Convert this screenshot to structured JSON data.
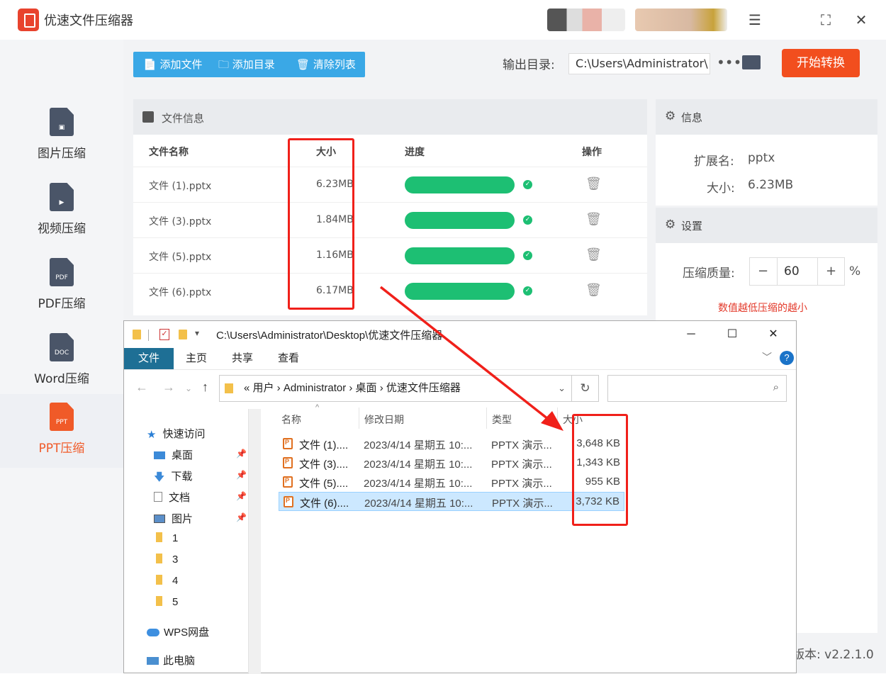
{
  "app": {
    "title": "优速文件压缩器"
  },
  "window_controls": {
    "menu": "☰",
    "maximize": "⛶",
    "close": "✕"
  },
  "sidebar": {
    "items": [
      {
        "label": "图片压缩",
        "icon": "image-file-icon",
        "badge": "▣"
      },
      {
        "label": "视频压缩",
        "icon": "video-file-icon",
        "badge": "▶"
      },
      {
        "label": "PDF压缩",
        "icon": "pdf-file-icon",
        "badge": "PDF"
      },
      {
        "label": "Word压缩",
        "icon": "doc-file-icon",
        "badge": "DOC"
      },
      {
        "label": "PPT压缩",
        "icon": "ppt-file-icon",
        "badge": "PPT",
        "active": true
      }
    ]
  },
  "toolbar": {
    "add_file": "添加文件",
    "add_dir": "添加目录",
    "clear_list": "清除列表"
  },
  "output": {
    "label": "输出目录:",
    "path": "C:\\Users\\Administrator\\",
    "more": "•••",
    "start": "开始转换"
  },
  "filepanel": {
    "title": "文件信息",
    "columns": {
      "name": "文件名称",
      "size": "大小",
      "progress": "进度",
      "action": "操作"
    },
    "rows": [
      {
        "name": "文件 (1).pptx",
        "size": "6.23MB",
        "progress": 1.0
      },
      {
        "name": "文件 (3).pptx",
        "size": "1.84MB",
        "progress": 1.0
      },
      {
        "name": "文件 (5).pptx",
        "size": "1.16MB",
        "progress": 1.0
      },
      {
        "name": "文件 (6).pptx",
        "size": "6.17MB",
        "progress": 1.0
      }
    ]
  },
  "info": {
    "title": "信息",
    "ext_label": "扩展名:",
    "ext_value": "pptx",
    "size_label": "大小:",
    "size_value": "6.23MB"
  },
  "settings": {
    "title": "设置",
    "quality_label": "压缩质量:",
    "minus": "−",
    "value": "60",
    "plus": "+",
    "unit": "%",
    "hint": "数值越低压缩的越小"
  },
  "version": "版本: v2.2.1.0",
  "explorer": {
    "title_path": "C:\\Users\\Administrator\\Desktop\\优速文件压缩器",
    "tabs": [
      "文件",
      "主页",
      "共享",
      "查看"
    ],
    "address": "«  用户  ›  Administrator  ›  桌面  ›  优速文件压缩器",
    "nav": [
      {
        "label": "快速访问",
        "icon": "star-icon"
      },
      {
        "label": "桌面",
        "icon": "desktop-icon",
        "pinned": true
      },
      {
        "label": "下载",
        "icon": "download-icon",
        "pinned": true
      },
      {
        "label": "文档",
        "icon": "document-icon",
        "pinned": true
      },
      {
        "label": "图片",
        "icon": "picture-icon",
        "pinned": true
      },
      {
        "label": "1",
        "icon": "folder-icon"
      },
      {
        "label": "3",
        "icon": "folder-icon"
      },
      {
        "label": "4",
        "icon": "folder-icon"
      },
      {
        "label": "5",
        "icon": "folder-icon"
      },
      {
        "label": "WPS网盘",
        "icon": "cloud-icon"
      },
      {
        "label": "此电脑",
        "icon": "computer-icon"
      }
    ],
    "columns": {
      "name": "名称",
      "modified": "修改日期",
      "type": "类型",
      "size": "大小"
    },
    "files": [
      {
        "name": "文件 (1)....",
        "modified": "2023/4/14 星期五 10:...",
        "type": "PPTX 演示...",
        "size": "3,648 KB"
      },
      {
        "name": "文件 (3)....",
        "modified": "2023/4/14 星期五 10:...",
        "type": "PPTX 演示...",
        "size": "1,343 KB"
      },
      {
        "name": "文件 (5)....",
        "modified": "2023/4/14 星期五 10:...",
        "type": "PPTX 演示...",
        "size": "955 KB"
      },
      {
        "name": "文件 (6)....",
        "modified": "2023/4/14 星期五 10:...",
        "type": "PPTX 演示...",
        "size": "3,732 KB",
        "selected": true
      }
    ]
  },
  "colors": {
    "accent_blue": "#3aa8e6",
    "start_red": "#f24e1e",
    "progress_green": "#1dbf73",
    "annotation_red": "#f0201a",
    "ppt_orange": "#f05a28"
  }
}
